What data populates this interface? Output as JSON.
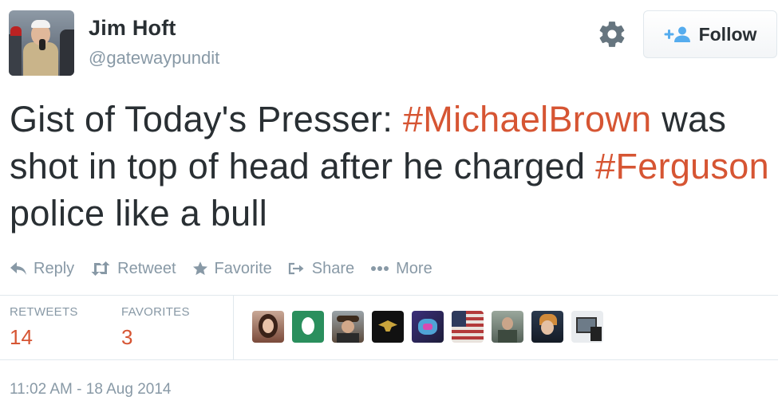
{
  "user": {
    "name": "Jim Hoft",
    "handle": "@gatewaypundit"
  },
  "follow_button": {
    "label": "Follow"
  },
  "tweet": {
    "parts": [
      {
        "text": "Gist of Today's Presser: ",
        "type": "text"
      },
      {
        "text": "#MichaelBrown",
        "type": "hashtag"
      },
      {
        "text": " was shot in top of head after he charged ",
        "type": "text"
      },
      {
        "text": "#Ferguson",
        "type": "hashtag"
      },
      {
        "text": " police like a bull",
        "type": "text"
      }
    ]
  },
  "actions": {
    "reply": "Reply",
    "retweet": "Retweet",
    "favorite": "Favorite",
    "share": "Share",
    "more": "More"
  },
  "stats": {
    "retweets_label": "RETWEETS",
    "retweets_value": "14",
    "favorites_label": "FAVORITES",
    "favorites_value": "3"
  },
  "timestamp": "11:02 AM - 18 Aug 2014",
  "colors": {
    "hashtag": "#d65533",
    "muted": "#8899a6",
    "text": "#292f33",
    "follow_icon": "#55acee"
  },
  "icons": {
    "settings": "gear-icon",
    "follow": "add-user-icon",
    "reply": "reply-icon",
    "retweet": "retweet-icon",
    "favorite": "star-icon",
    "share": "share-icon",
    "more": "more-dots-icon"
  }
}
